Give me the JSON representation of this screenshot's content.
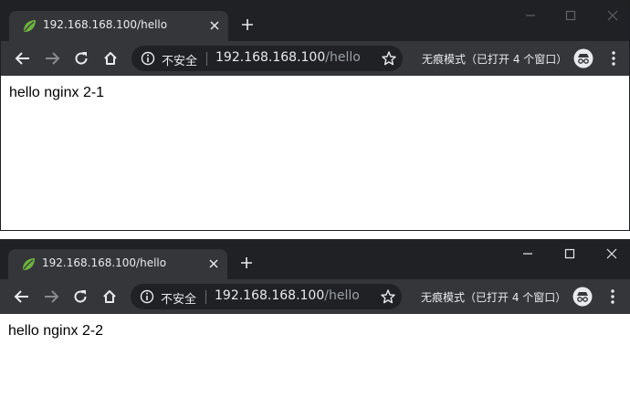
{
  "windows": [
    {
      "tab": {
        "title": "192.168.168.100/hello",
        "favicon": "spring-leaf-icon"
      },
      "omnibox": {
        "security_label": "不安全",
        "url_host": "192.168.168.100",
        "url_path": "/hello"
      },
      "incognito_label": "无痕模式（已打开 4 个窗口）",
      "page_text": "hello nginx 2-1"
    },
    {
      "tab": {
        "title": "192.168.168.100/hello",
        "favicon": "spring-leaf-icon"
      },
      "omnibox": {
        "security_label": "不安全",
        "url_host": "192.168.168.100",
        "url_path": "/hello"
      },
      "incognito_label": "无痕模式（已打开 4 个窗口）",
      "page_text": "hello nginx 2-2"
    }
  ],
  "colors": {
    "titlebar": "#202124",
    "toolbar": "#35363a",
    "omnibox": "#202124",
    "favicon_green": "#6db33f",
    "text_light": "#e8eaed",
    "text_dim": "#9aa0a6"
  }
}
